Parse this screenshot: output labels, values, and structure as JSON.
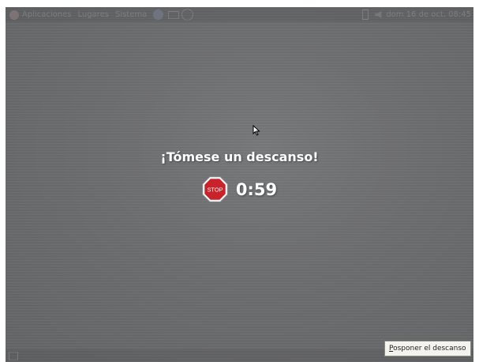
{
  "top_panel": {
    "menus": [
      "Aplicaciones",
      "Lugares",
      "Sistema"
    ],
    "clock": "dom 16 de oct, 08:45"
  },
  "break_screen": {
    "message": "¡Tómese un descanso!",
    "stop_sign_text": "STOP",
    "countdown": "0:59",
    "postpone_button": {
      "mnemonic": "P",
      "rest": "osponer el descanso"
    }
  },
  "colors": {
    "stop_red": "#c8222b",
    "overlay_gray": "#6a6b6d"
  }
}
